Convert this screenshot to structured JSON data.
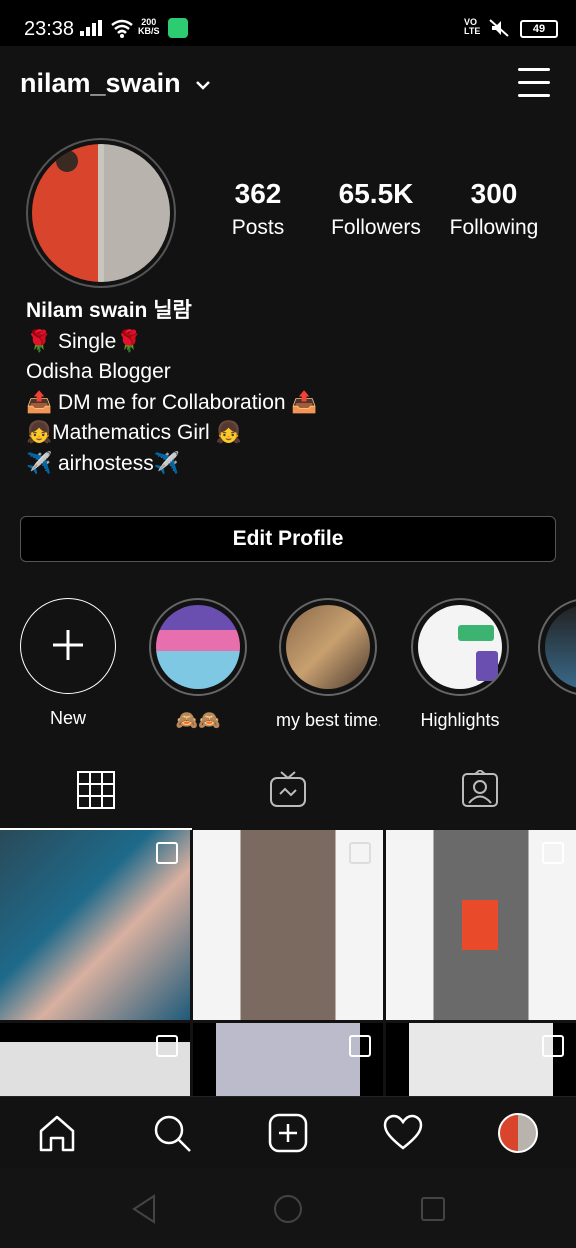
{
  "status_bar": {
    "time": "23:38",
    "speed_value": "200",
    "speed_unit": "KB/S",
    "network_top": "VO",
    "network_bottom": "LTE",
    "battery": "49"
  },
  "header": {
    "username": "nilam_swain",
    "chevron_icon": "chevron-down-icon",
    "menu_icon": "hamburger-menu-icon"
  },
  "profile": {
    "stats": [
      {
        "value": "362",
        "label": "Posts"
      },
      {
        "value": "65.5K",
        "label": "Followers"
      },
      {
        "value": "300",
        "label": "Following"
      }
    ],
    "bio": {
      "name": "Nilam swain 닐람",
      "lines": [
        "🌹 Single🌹",
        "Odisha Blogger",
        "📤 DM me for Collaboration 📤",
        "👧Mathematics Girl 👧",
        "✈️ airhostess✈️"
      ]
    },
    "edit_button": "Edit Profile"
  },
  "highlights": [
    {
      "label": "New",
      "icon": "plus-icon"
    },
    {
      "label": "🙈🙈"
    },
    {
      "label": "my best time..."
    },
    {
      "label": "Highlights"
    },
    {
      "label": ""
    }
  ],
  "tabs": [
    {
      "name": "grid",
      "icon": "grid-icon"
    },
    {
      "name": "igtv",
      "icon": "igtv-icon"
    },
    {
      "name": "tagged",
      "icon": "tagged-person-icon"
    }
  ],
  "bottom_nav": [
    {
      "name": "home",
      "icon": "home-icon"
    },
    {
      "name": "search",
      "icon": "search-icon"
    },
    {
      "name": "create",
      "icon": "add-post-icon"
    },
    {
      "name": "activity",
      "icon": "heart-icon"
    },
    {
      "name": "profile",
      "icon": "profile-avatar-icon"
    }
  ],
  "colors": {
    "background": "#121212",
    "text": "#ffffff",
    "border": "#555555"
  }
}
